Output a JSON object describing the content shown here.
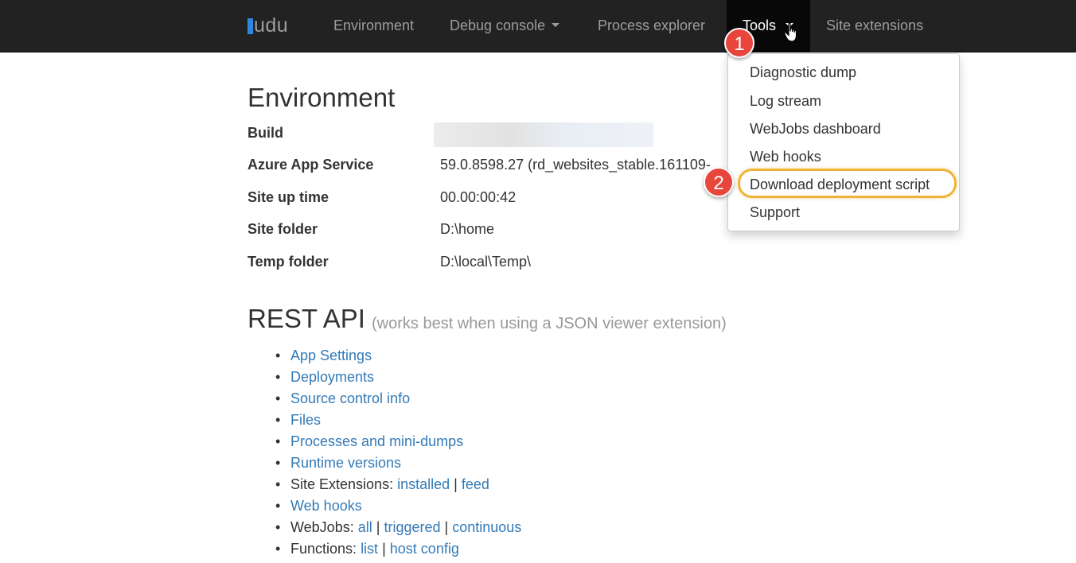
{
  "navbar": {
    "brand": "udu",
    "items": {
      "environment": "Environment",
      "debug_console": "Debug console",
      "process_explorer": "Process explorer",
      "tools": "Tools",
      "site_extensions": "Site extensions"
    }
  },
  "tools_menu": {
    "items": [
      "Diagnostic dump",
      "Log stream",
      "WebJobs dashboard",
      "Web hooks",
      "Download deployment script",
      "Support"
    ]
  },
  "annotations": {
    "step1": "1",
    "step2": "2"
  },
  "environment": {
    "title": "Environment",
    "rows": [
      {
        "key": "Build",
        "value": ""
      },
      {
        "key": "Azure App Service",
        "value": "59.0.8598.27 (rd_websites_stable.161109-"
      },
      {
        "key": "Site up time",
        "value": "00.00:00:42"
      },
      {
        "key": "Site folder",
        "value": "D:\\home"
      },
      {
        "key": "Temp folder",
        "value": "D:\\local\\Temp\\"
      }
    ]
  },
  "rest_api": {
    "title": "REST API",
    "subtitle": "(works best when using a JSON viewer extension)",
    "links": {
      "app_settings": "App Settings",
      "deployments": "Deployments",
      "source_control_info": "Source control info",
      "files": "Files",
      "processes": "Processes and mini-dumps",
      "runtime_versions": "Runtime versions",
      "site_extensions_label": "Site Extensions:",
      "site_extensions_installed": "installed",
      "site_extensions_feed": "feed",
      "web_hooks": "Web hooks",
      "webjobs_label": "WebJobs:",
      "webjobs_all": "all",
      "webjobs_triggered": "triggered",
      "webjobs_continuous": "continuous",
      "functions_label": "Functions:",
      "functions_list": "list",
      "functions_host_config": "host config",
      "separator": "|"
    }
  },
  "colors": {
    "navbar": "#222222",
    "link": "#337ab7",
    "highlight": "#f0b33a",
    "badge": "#e8453c"
  }
}
